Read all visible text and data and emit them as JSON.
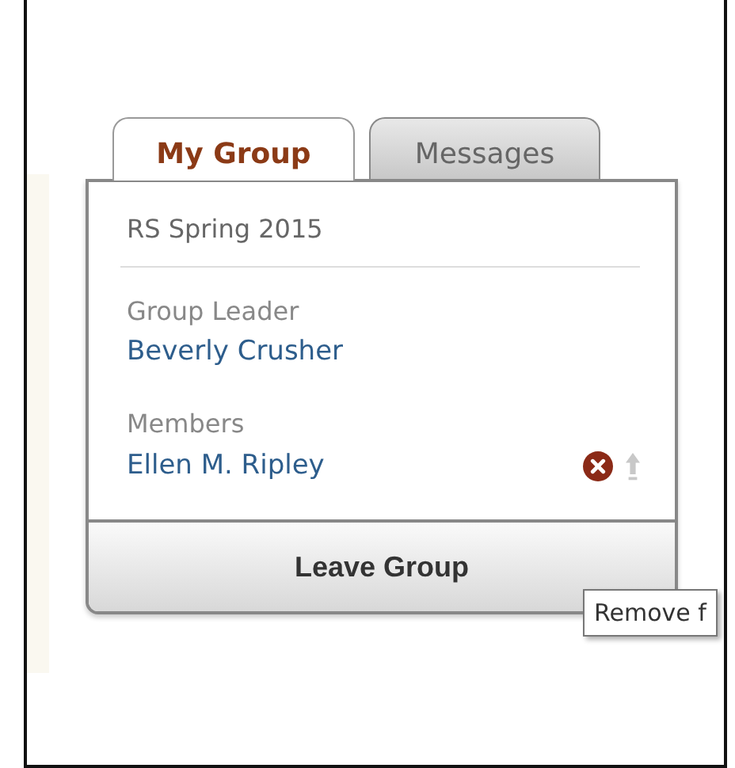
{
  "tabs": [
    {
      "label": "My Group",
      "selected": true
    },
    {
      "label": "Messages",
      "selected": false
    }
  ],
  "group_name": "RS Spring 2015",
  "leader": {
    "label": "Group Leader",
    "name": "Beverly Crusher"
  },
  "members": {
    "label": "Members",
    "items": [
      {
        "name": "Ellen M. Ripley"
      }
    ]
  },
  "leave_button": "Leave Group",
  "tooltip": "Remove f"
}
